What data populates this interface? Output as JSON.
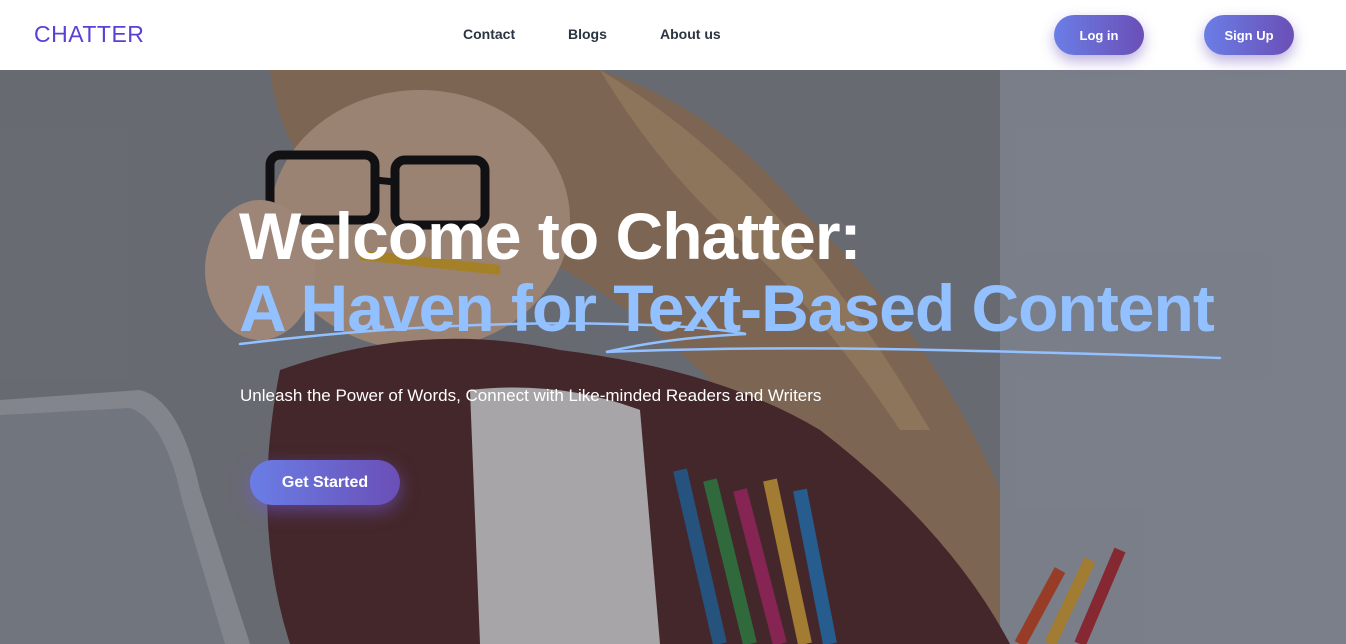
{
  "nav": {
    "brand": "CHATTER",
    "links": [
      {
        "label": "Contact"
      },
      {
        "label": "Blogs"
      },
      {
        "label": "About us"
      }
    ],
    "login_label": "Log in",
    "signup_label": "Sign Up"
  },
  "hero": {
    "title_line1": "Welcome to Chatter:",
    "title_line2": "A Haven for Text-Based Content",
    "subtitle": "Unleash the Power of Words, Connect with Like-minded Readers and Writers",
    "cta_label": "Get Started"
  },
  "colors": {
    "brand": "#5b3fd6",
    "accent_text": "#93c0ff",
    "button_gradient_start": "#6a7ee6",
    "button_gradient_end": "#6a4fb6",
    "nav_text": "#2b3441"
  }
}
